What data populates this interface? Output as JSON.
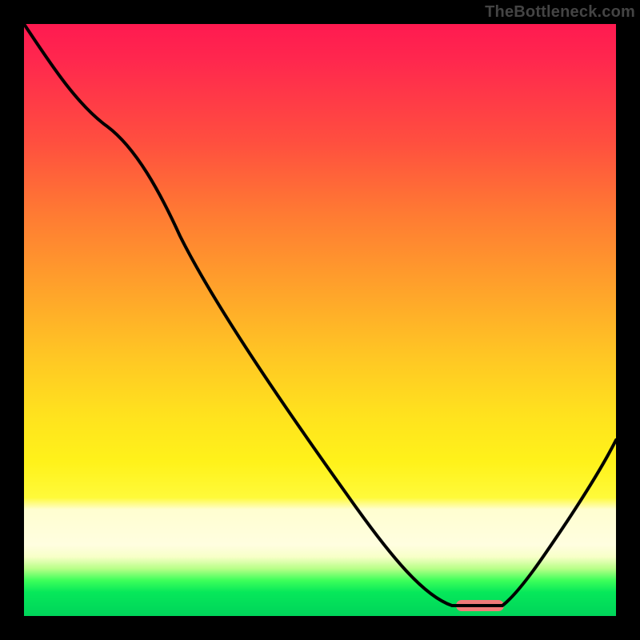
{
  "watermark": "TheBottleneck.com",
  "chart_data": {
    "type": "line",
    "title": "",
    "xlabel": "",
    "ylabel": "",
    "xlim": [
      0,
      100
    ],
    "ylim": [
      0,
      100
    ],
    "series": [
      {
        "name": "bottleneck-curve",
        "x": [
          0,
          6,
          14,
          21,
          26,
          40,
          55,
          68,
          73,
          77,
          81,
          86,
          92,
          100
        ],
        "values": [
          100,
          93,
          83,
          73,
          64,
          42,
          21,
          3,
          1,
          1,
          1,
          6,
          16,
          30
        ]
      }
    ],
    "marker": {
      "name": "optimal-range-pill",
      "color": "#f07a78",
      "x_start": 73,
      "x_end": 81,
      "y": 1,
      "thickness_pct": 2
    },
    "background_gradient": {
      "top_color": "#ff1a50",
      "mid_color": "#ffe21e",
      "band_color": "#fffee0",
      "bottom_color": "#00d45a"
    }
  }
}
